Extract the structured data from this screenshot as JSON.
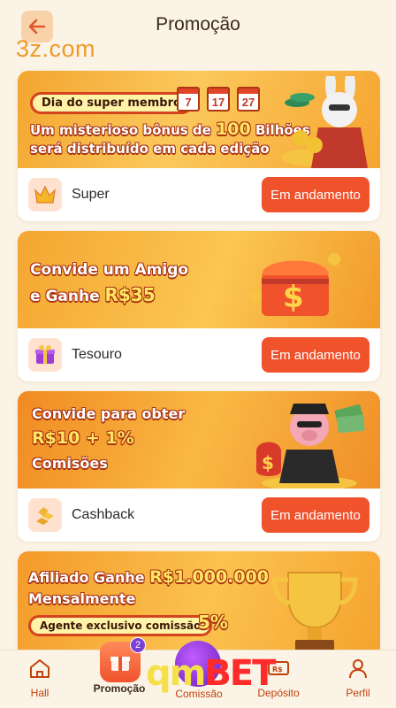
{
  "header": {
    "title": "Promoção",
    "watermark": "3z.com"
  },
  "cards": [
    {
      "banner": {
        "pill": "Dia do super membro",
        "calendar": [
          "7",
          "17",
          "27"
        ],
        "line1a": "Um misterioso bônus de",
        "line1b": "100",
        "line1c": "Bilhões",
        "line2": "será distribuído em cada edição"
      },
      "name": "Super",
      "status": "Em andamento"
    },
    {
      "banner": {
        "line1": "Convide um Amigo",
        "line2a": "e Ganhe",
        "line2b": "R$35"
      },
      "name": "Tesouro",
      "status": "Em andamento"
    },
    {
      "banner": {
        "line1": "Convide para obter",
        "line2": "R$10 + 1%",
        "line3": "Comisões"
      },
      "name": "Cashback",
      "status": "Em andamento"
    },
    {
      "banner": {
        "line1a": "Afiliado Ganhe",
        "line1b": "R$1.000.000",
        "line2": "Mensalmente",
        "pill": "Agente exclusivo comissão",
        "pct": "5%"
      }
    }
  ],
  "nav": {
    "items": [
      "Hall",
      "Promoção",
      "Comissão",
      "Depósito",
      "Perfil"
    ],
    "promo_count": "2",
    "brand_q": "qm",
    "brand_b": "BET"
  },
  "colors": {
    "accent": "#f0522c",
    "background": "#fbf3e6",
    "nav_text": "#c2410c"
  },
  "icons": {
    "back": "arrow-left-icon",
    "super": "crown-icon",
    "tesouro": "gift-box-icon",
    "cashback": "gold-bars-icon",
    "hall": "home-icon",
    "promo": "gift-icon",
    "deposit": "cash-icon",
    "profile": "person-icon"
  }
}
